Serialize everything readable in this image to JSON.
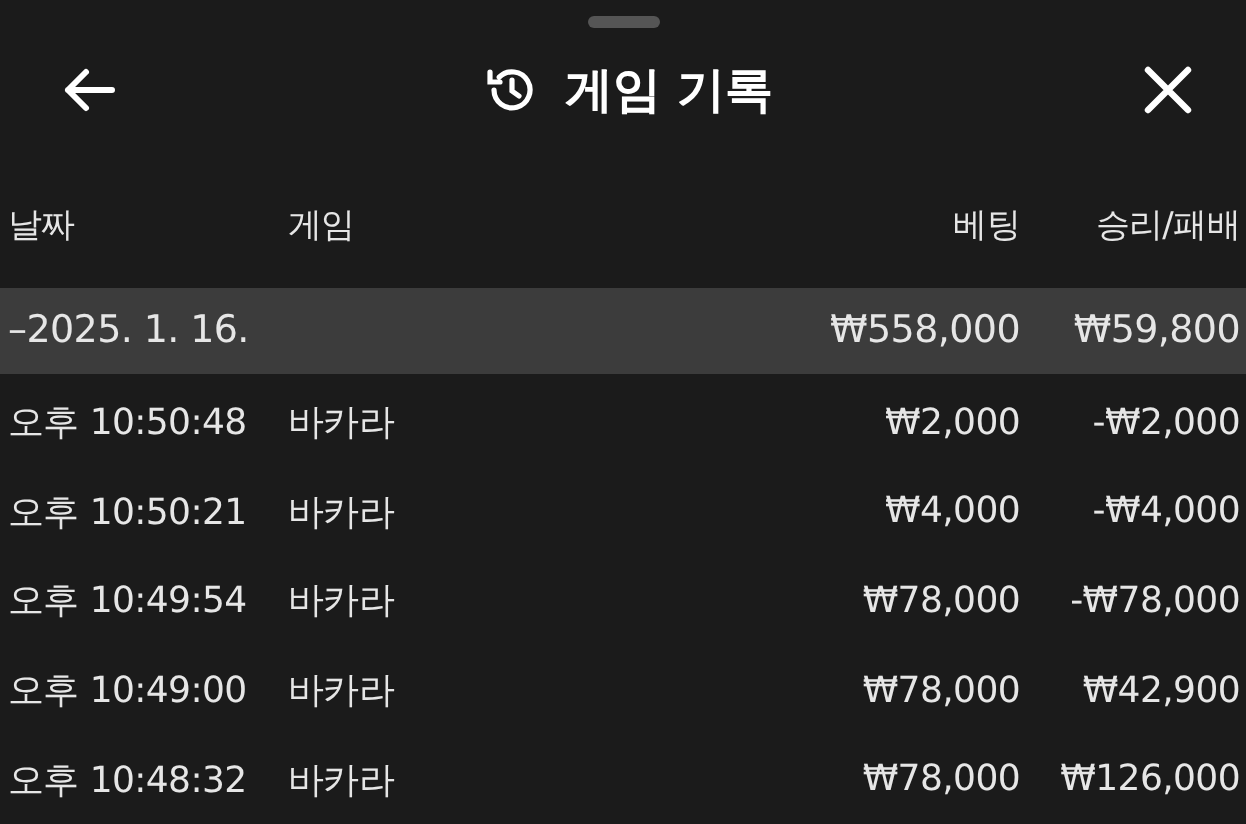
{
  "header": {
    "title": "게임 기록"
  },
  "table": {
    "columns": [
      "날짜",
      "게임",
      "베팅",
      "승리/패배"
    ],
    "group": {
      "date": "–2025. 1. 16.",
      "bet": "₩558,000",
      "result": "₩59,800"
    },
    "rows": [
      {
        "time": "오후 10:50:48",
        "game": "바카라",
        "bet": "₩2,000",
        "result": "-₩2,000"
      },
      {
        "time": "오후 10:50:21",
        "game": "바카라",
        "bet": "₩4,000",
        "result": "-₩4,000"
      },
      {
        "time": "오후 10:49:54",
        "game": "바카라",
        "bet": "₩78,000",
        "result": "-₩78,000"
      },
      {
        "time": "오후 10:49:00",
        "game": "바카라",
        "bet": "₩78,000",
        "result": "₩42,900"
      },
      {
        "time": "오후 10:48:32",
        "game": "바카라",
        "bet": "₩78,000",
        "result": "₩126,000"
      }
    ]
  }
}
